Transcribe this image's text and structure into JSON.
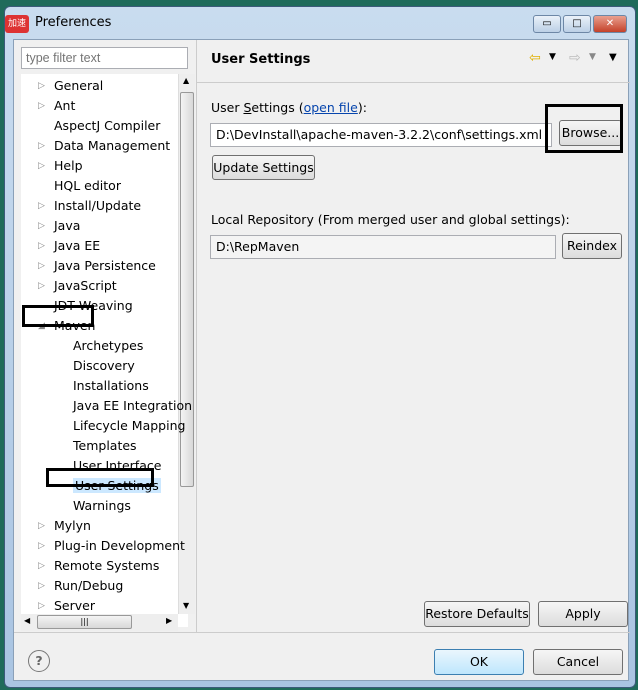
{
  "window": {
    "title": "Preferences",
    "app_icon_text": "加速"
  },
  "filter": {
    "placeholder": "type filter text"
  },
  "tree": {
    "items": [
      {
        "label": "General",
        "expander": true,
        "level": 0
      },
      {
        "label": "Ant",
        "expander": true,
        "level": 0
      },
      {
        "label": "AspectJ Compiler",
        "expander": false,
        "level": 0
      },
      {
        "label": "Data Management",
        "expander": true,
        "level": 0
      },
      {
        "label": "Help",
        "expander": true,
        "level": 0
      },
      {
        "label": "HQL editor",
        "expander": false,
        "level": 0
      },
      {
        "label": "Install/Update",
        "expander": true,
        "level": 0
      },
      {
        "label": "Java",
        "expander": true,
        "level": 0
      },
      {
        "label": "Java EE",
        "expander": true,
        "level": 0
      },
      {
        "label": "Java Persistence",
        "expander": true,
        "level": 0
      },
      {
        "label": "JavaScript",
        "expander": true,
        "level": 0
      },
      {
        "label": "JDT Weaving",
        "expander": false,
        "level": 0
      },
      {
        "label": "Maven",
        "expander": true,
        "expanded": true,
        "level": 0
      },
      {
        "label": "Archetypes",
        "level": 1
      },
      {
        "label": "Discovery",
        "level": 1
      },
      {
        "label": "Installations",
        "level": 1
      },
      {
        "label": "Java EE Integration",
        "level": 1
      },
      {
        "label": "Lifecycle Mapping",
        "level": 1
      },
      {
        "label": "Templates",
        "level": 1
      },
      {
        "label": "User Interface",
        "level": 1
      },
      {
        "label": "User Settings",
        "level": 1,
        "selected": true
      },
      {
        "label": "Warnings",
        "level": 1
      },
      {
        "label": "Mylyn",
        "expander": true,
        "level": 0
      },
      {
        "label": "Plug-in Development",
        "expander": true,
        "level": 0
      },
      {
        "label": "Remote Systems",
        "expander": true,
        "level": 0
      },
      {
        "label": "Run/Debug",
        "expander": true,
        "level": 0
      },
      {
        "label": "Server",
        "expander": true,
        "level": 0
      }
    ]
  },
  "page": {
    "title": "User Settings",
    "user_settings_label_pre": "User ",
    "user_settings_label_mnemonic": "S",
    "user_settings_label_mid": "ettings (",
    "open_file_link": "open file",
    "user_settings_label_post": "):",
    "settings_path": "D:\\DevInstall\\apache-maven-3.2.2\\conf\\settings.xml",
    "browse_button": "Browse...",
    "update_button": "Update Settings",
    "local_repo_label": "Local Repository (From merged user and global settings):",
    "local_repo_path": "D:\\RepMaven",
    "reindex_button": "Reindex",
    "restore_defaults_button": "Restore Defaults",
    "apply_button": "Apply"
  },
  "footer": {
    "ok_button": "OK",
    "cancel_button": "Cancel",
    "help_icon": "?"
  }
}
